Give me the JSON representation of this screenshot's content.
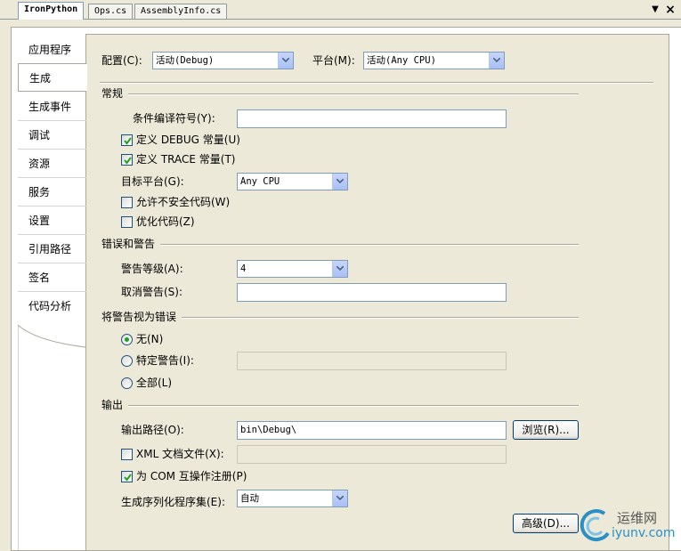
{
  "tabs": [
    {
      "label": "IronPython"
    },
    {
      "label": "Ops.cs"
    },
    {
      "label": "AssemblyInfo.cs"
    }
  ],
  "sidebar": {
    "items": [
      {
        "label": "应用程序"
      },
      {
        "label": "生成"
      },
      {
        "label": "生成事件"
      },
      {
        "label": "调试"
      },
      {
        "label": "资源"
      },
      {
        "label": "服务"
      },
      {
        "label": "设置"
      },
      {
        "label": "引用路径"
      },
      {
        "label": "签名"
      },
      {
        "label": "代码分析"
      }
    ],
    "selected": "生成"
  },
  "config": {
    "config_label": "配置(C):",
    "config_value": "活动(Debug)",
    "platform_label": "平台(M):",
    "platform_value": "活动(Any CPU)"
  },
  "general": {
    "title": "常规",
    "cond_symbols_label": "条件编译符号(Y):",
    "cond_symbols_value": "",
    "define_debug": "定义 DEBUG 常量(U)",
    "define_debug_checked": true,
    "define_trace": "定义 TRACE 常量(T)",
    "define_trace_checked": true,
    "target_label": "目标平台(G):",
    "target_value": "Any CPU",
    "unsafe_label": "允许不安全代码(W)",
    "unsafe_checked": false,
    "optimize_label": "优化代码(Z)",
    "optimize_checked": false
  },
  "errors": {
    "title": "错误和警告",
    "warning_level_label": "警告等级(A):",
    "warning_level_value": "4",
    "suppress_label": "取消警告(S):",
    "suppress_value": ""
  },
  "treat": {
    "title": "将警告视为错误",
    "none_label": "无(N)",
    "specific_label": "特定警告(I):",
    "all_label": "全部(L)",
    "selected": "none"
  },
  "output": {
    "title": "输出",
    "path_label": "输出路径(O):",
    "path_value": "bin\\Debug\\",
    "browse_label": "浏览(R)...",
    "xml_label": "XML 文档文件(X):",
    "xml_checked": false,
    "com_label": "为 COM 互操作注册(P)",
    "com_checked": true,
    "serialization_label": "生成序列化程序集(E):",
    "serialization_value": "自动",
    "advanced_label": "高级(D)..."
  },
  "watermark": {
    "cn": "运维网",
    "url": "iyunv.com"
  },
  "colors": {
    "background": "#ece9d8",
    "border": "#7f9db9",
    "check": "#21a121",
    "watermark": "#2a8fc7"
  }
}
